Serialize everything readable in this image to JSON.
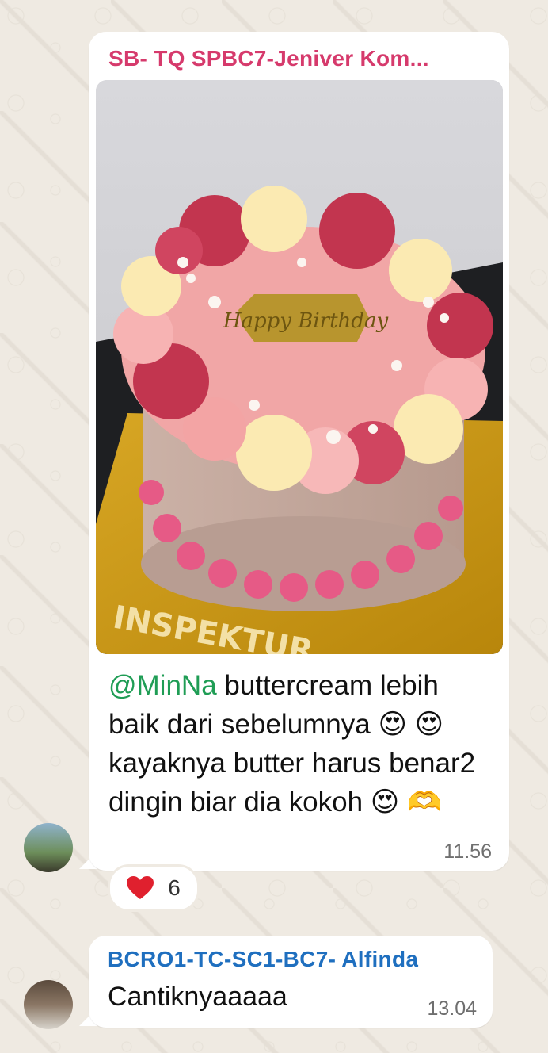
{
  "messages": [
    {
      "sender": "SB- TQ SPBC7-Jeniver Kom...",
      "sender_color": "#d63a6c",
      "image_alt": "Birthday cake with buttercream rosettes",
      "cake_topper_text": "Happy Birthday",
      "cake_board_text": "INSPEKTUR",
      "mention": "@MinNa",
      "body": " buttercream lebih baik dari sebelumnya 😍 😍 kayaknya butter harus benar2 dingin biar dia kokoh 😍 🫶",
      "time": "11.56",
      "reaction": {
        "emoji": "heart",
        "count": "6",
        "color": "#e0202e"
      }
    },
    {
      "sender": "BCRO1-TC-SC1-BC7- Alfinda",
      "sender_color": "#1f6fbf",
      "body": "Cantiknyaaaaa",
      "time": "13.04"
    }
  ]
}
